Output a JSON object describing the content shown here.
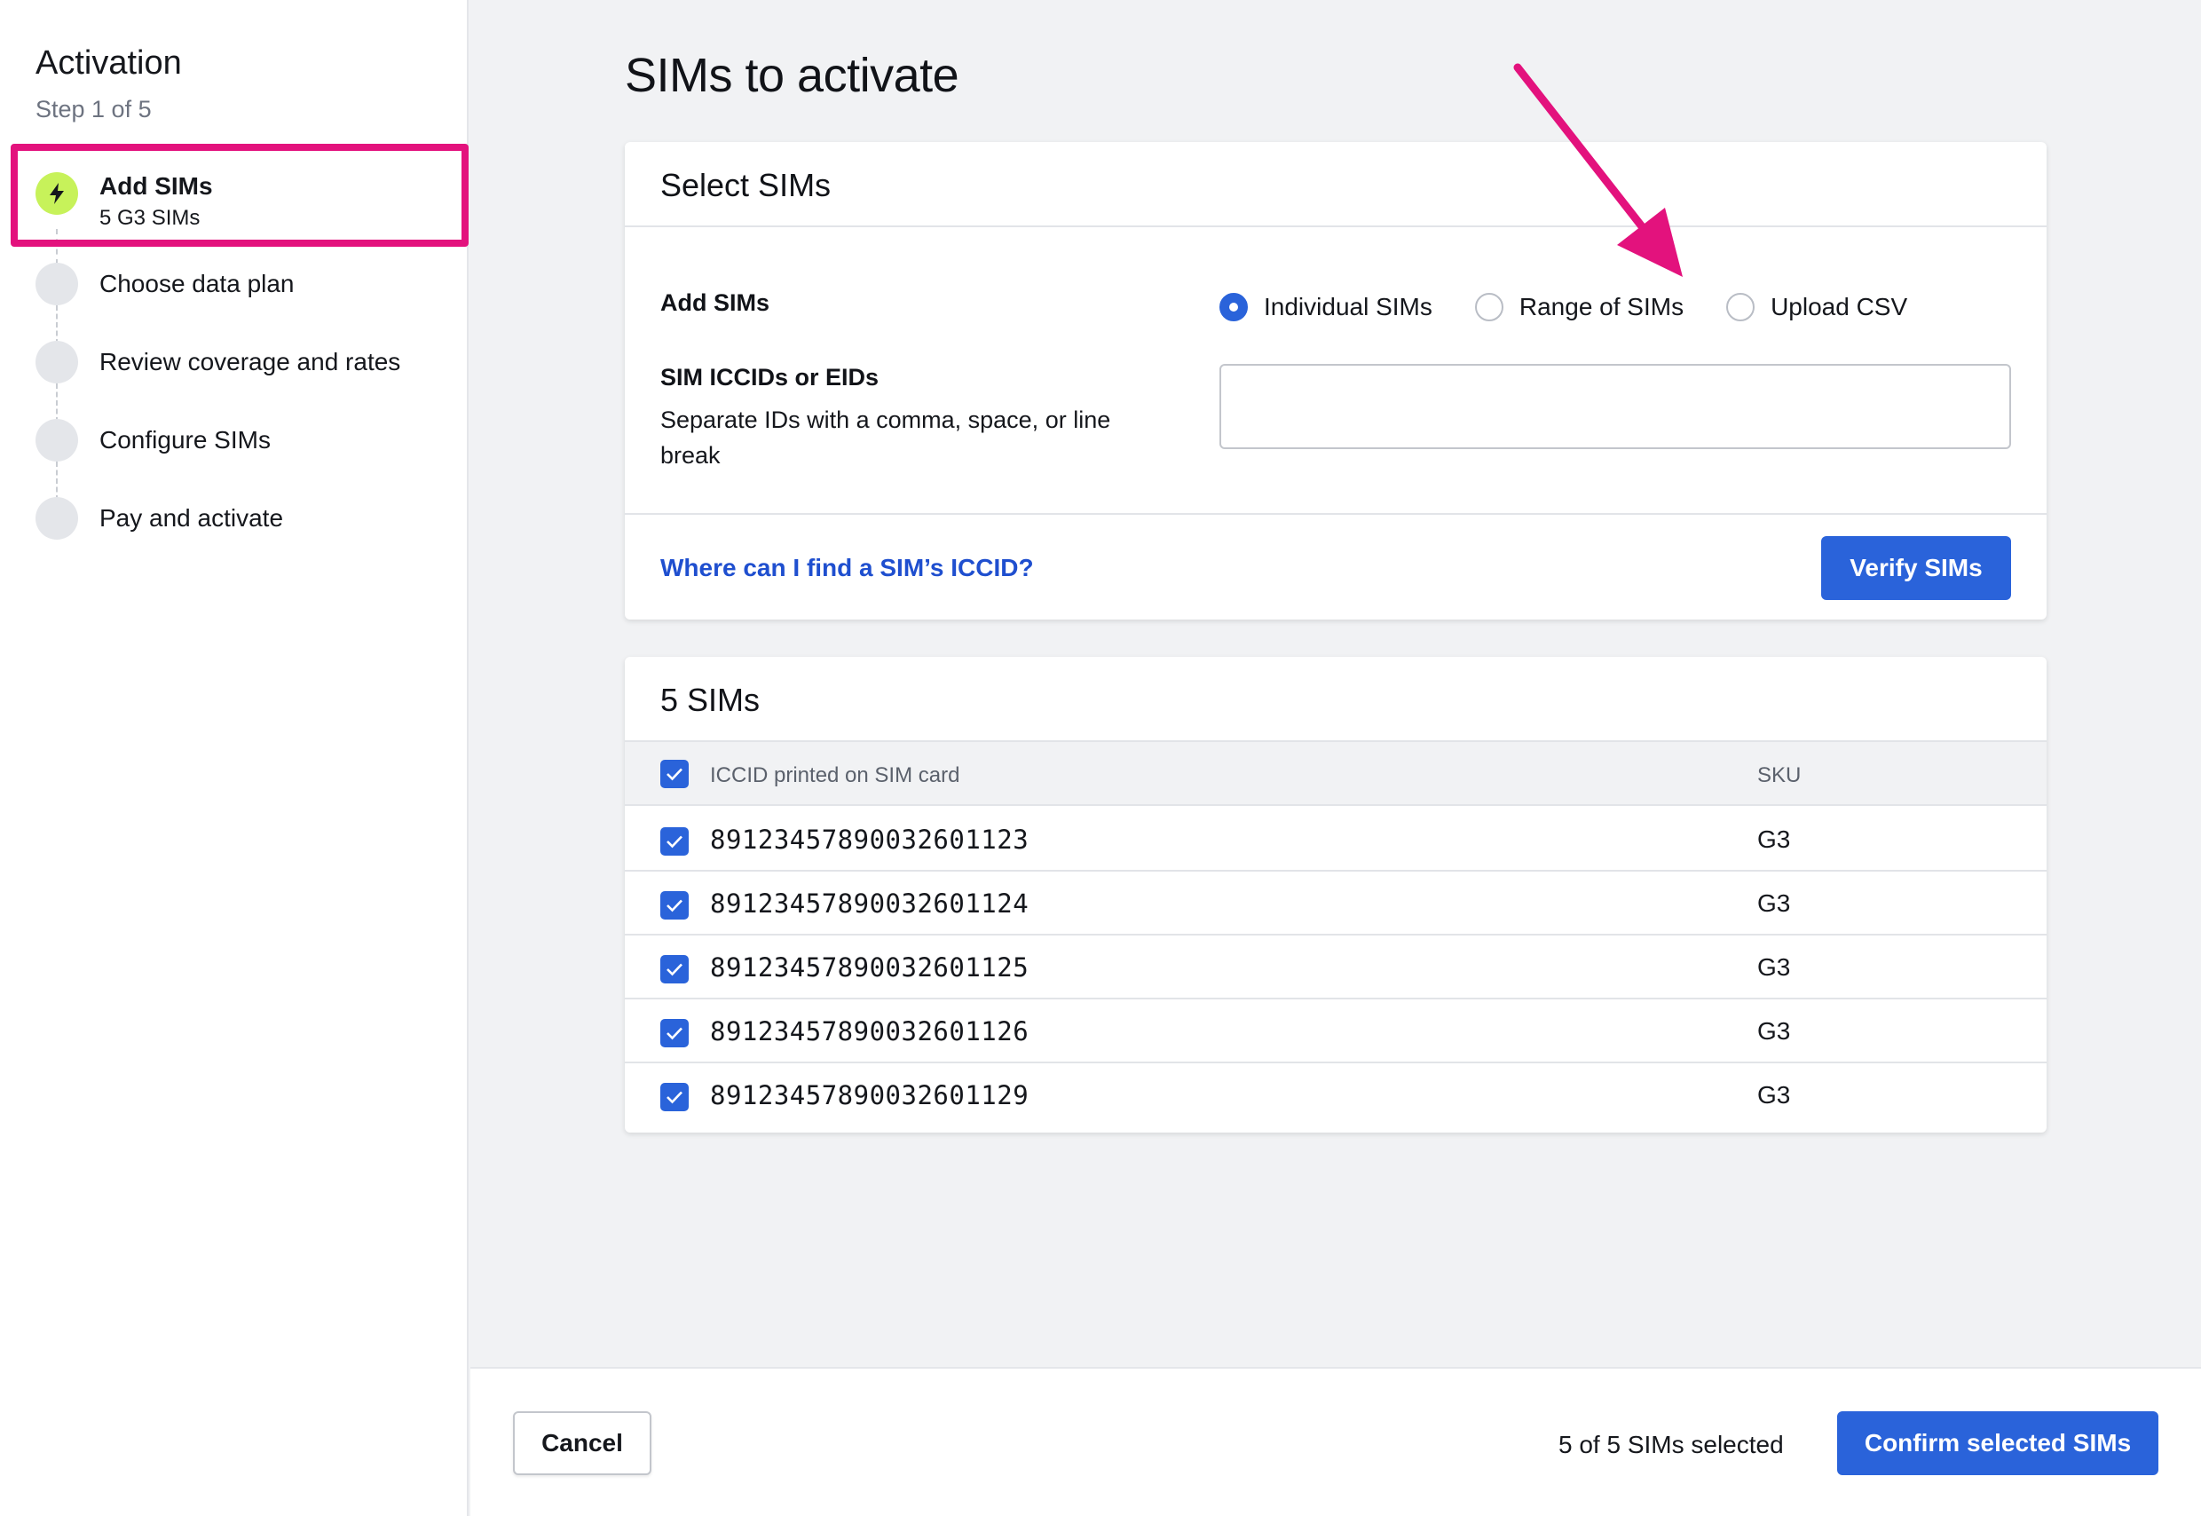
{
  "sidebar": {
    "title": "Activation",
    "step_indicator": "Step 1 of 5",
    "steps": [
      {
        "label": "Add SIMs",
        "sublabel": "5 G3 SIMs"
      },
      {
        "label": "Choose data plan"
      },
      {
        "label": "Review coverage and rates"
      },
      {
        "label": "Configure SIMs"
      },
      {
        "label": "Pay and activate"
      }
    ]
  },
  "main": {
    "title": "SIMs to activate",
    "select_card": {
      "title": "Select SIMs",
      "add_label": "Add SIMs",
      "options": [
        {
          "label": "Individual SIMs",
          "checked": true
        },
        {
          "label": "Range of SIMs",
          "checked": false
        },
        {
          "label": "Upload CSV",
          "checked": false
        }
      ],
      "iccid_label": "SIM ICCIDs or EIDs",
      "iccid_help": "Separate IDs with a comma, space, or line break",
      "iccid_value": "",
      "help_link": "Where can I find a SIM’s ICCID?",
      "verify_label": "Verify SIMs"
    },
    "list_card": {
      "title": "5 SIMs",
      "columns": {
        "iccid": "ICCID printed on SIM card",
        "sku": "SKU"
      },
      "rows": [
        {
          "iccid": "89123457890032601123",
          "sku": "G3"
        },
        {
          "iccid": "89123457890032601124",
          "sku": "G3"
        },
        {
          "iccid": "89123457890032601125",
          "sku": "G3"
        },
        {
          "iccid": "89123457890032601126",
          "sku": "G3"
        },
        {
          "iccid": "89123457890032601129",
          "sku": "G3"
        }
      ]
    }
  },
  "footer": {
    "cancel_label": "Cancel",
    "selected_text": "5 of 5 SIMs selected",
    "confirm_label": "Confirm selected SIMs"
  },
  "icons": {
    "active_step": "lightning-bolt-icon",
    "checkbox": "check-icon",
    "annotation": "pointer-arrow-icon"
  },
  "colors": {
    "accent": "#2a63da",
    "link": "#1f4fcf",
    "highlight": "#e3127d",
    "active_step": "#c7f25a"
  }
}
